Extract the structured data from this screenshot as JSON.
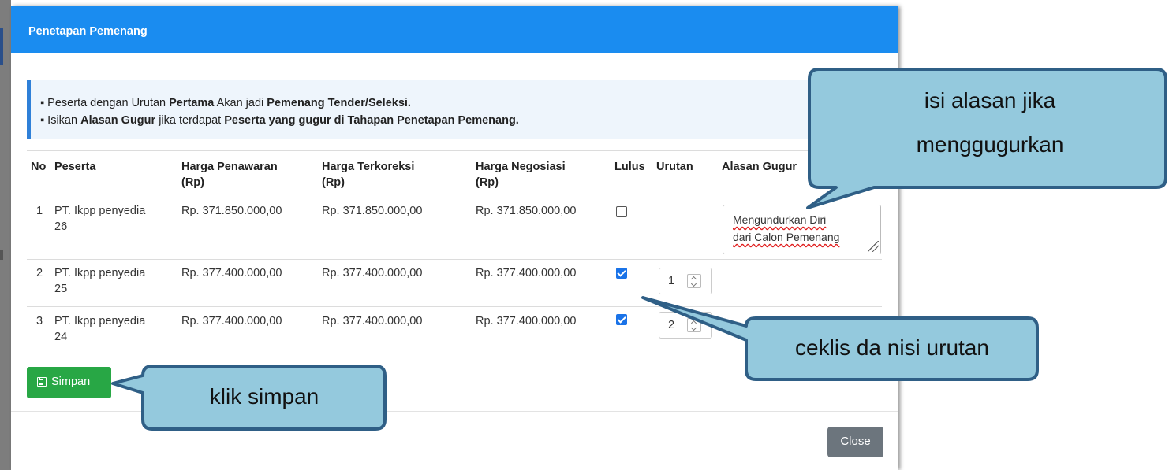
{
  "modal": {
    "title": "Penetapan Pemenang",
    "info": {
      "line1": {
        "p1": "Peserta dengan Urutan ",
        "b1": "Pertama",
        "p2": " Akan jadi ",
        "b2": "Pemenang Tender/Seleksi."
      },
      "line2": {
        "p1": "Isikan ",
        "b1": "Alasan Gugur",
        "p2": " jika terdapat ",
        "b2": "Peserta yang gugur di Tahapan Penetapan Pemenang."
      }
    },
    "table": {
      "headers": {
        "no": "No",
        "peserta": "Peserta",
        "harga_penawaran": "Harga Penawaran",
        "harga_terkoreksi": "Harga Terkoreksi",
        "harga_negosiasi": "Harga Negosiasi",
        "rp": "(Rp)",
        "lulus": "Lulus",
        "urutan": "Urutan",
        "alasan_gugur": "Alasan Gugur"
      },
      "rows": [
        {
          "no": "1",
          "peserta_line1": "PT. Ikpp penyedia",
          "peserta_line2": "26",
          "harga_penawaran": "Rp. 371.850.000,00",
          "harga_terkoreksi": "Rp. 371.850.000,00",
          "harga_negosiasi": "Rp. 371.850.000,00",
          "lulus": false,
          "urutan": "",
          "alasan_line1": "Mengundurkan Diri",
          "alasan_line2": "dari Calon Pemenang"
        },
        {
          "no": "2",
          "peserta_line1": "PT. Ikpp penyedia",
          "peserta_line2": "25",
          "harga_penawaran": "Rp. 377.400.000,00",
          "harga_terkoreksi": "Rp. 377.400.000,00",
          "harga_negosiasi": "Rp. 377.400.000,00",
          "lulus": true,
          "urutan": "1"
        },
        {
          "no": "3",
          "peserta_line1": "PT. Ikpp penyedia",
          "peserta_line2": "24",
          "harga_penawaran": "Rp. 377.400.000,00",
          "harga_terkoreksi": "Rp. 377.400.000,00",
          "harga_negosiasi": "Rp. 377.400.000,00",
          "lulus": true,
          "urutan": "2"
        }
      ]
    },
    "buttons": {
      "simpan": "Simpan",
      "close": "Close"
    }
  },
  "callouts": {
    "alasan_line1": "isi alasan jika",
    "alasan_line2": "menggugurkan",
    "ceklis": "ceklis da nisi urutan",
    "simpan": "klik simpan",
    "fill_color": "#94c9dd",
    "stroke_color": "#2f5f86"
  },
  "colors": {
    "header": "#1a8cf0",
    "simpan_button": "#28a745",
    "close_button": "#6c757d",
    "checkbox_checked": "#1a73e8"
  },
  "icons": {
    "save": "floppy-disk-icon",
    "spin": "spin-up-down-icon"
  }
}
